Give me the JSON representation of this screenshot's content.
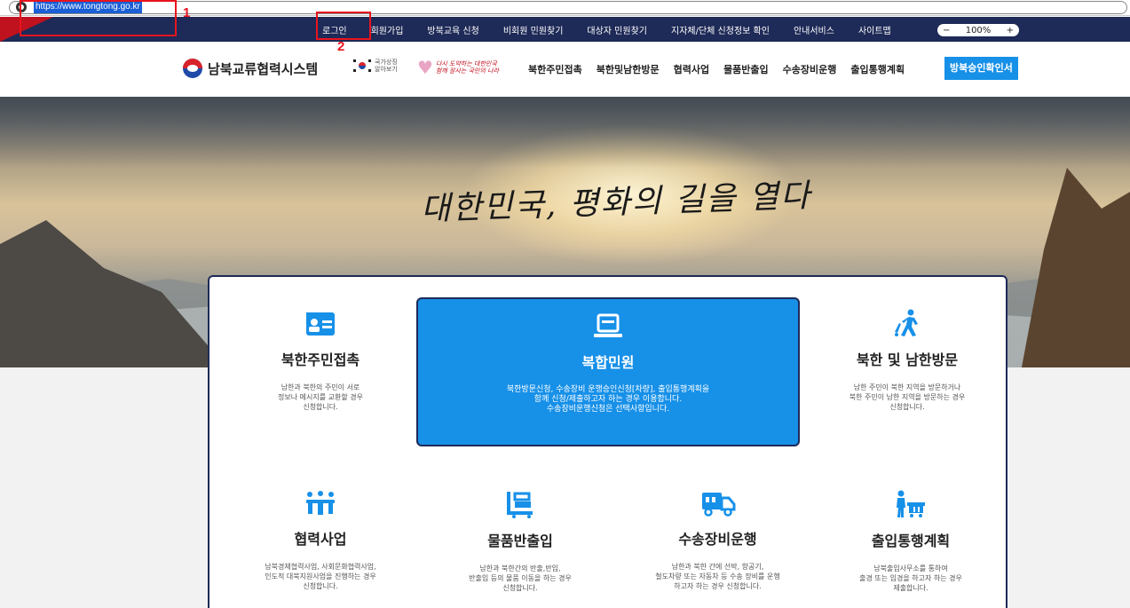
{
  "browser": {
    "url": "https://www.tongtong.go.kr"
  },
  "annotations": {
    "one": "1",
    "two": "2",
    "color": "#e8141e"
  },
  "utility": {
    "items": [
      "로그인",
      "회원가입",
      "방북교육 신청",
      "비회원 민원찾기",
      "대상자 민원찾기",
      "지자체/단체 신청정보 확인",
      "안내서비스",
      "사이트맵"
    ],
    "zoom": {
      "minus": "−",
      "value": "100%",
      "plus": "+"
    }
  },
  "header": {
    "logo_text": "남북교류협력시스템",
    "badge1_line1": "국가상징",
    "badge1_line2": "알아보기",
    "badge2_line1": "다시 도약하는 대한민국",
    "badge2_line2": "함께 잘사는 국민의 나라",
    "nav": [
      "북한주민접촉",
      "북한및남한방문",
      "협력사업",
      "물품반출입",
      "수송장비운행",
      "출입통행계획"
    ],
    "cta": "방북승인확인서"
  },
  "hero": {
    "slogan": "대한민국, 평화의 길을 열다"
  },
  "services": [
    {
      "title": "북한주민접촉",
      "icon": "id-card-icon",
      "desc": [
        "남한과 북한의 주민이 서로",
        "정보나 메시지를 교환할 경우",
        "신청합니다."
      ]
    },
    {
      "title": "복합민원",
      "icon": "laptop-icon",
      "desc": [
        "북한방문신청, 수송장비 운행승인신청[차량], 출입통행계획을",
        "함께 신청/제출하고자 하는 경우 이용합니다.",
        "수송장비운행신청은 선택사항입니다."
      ]
    },
    {
      "title": "북한 및 남한방문",
      "icon": "walking-person-icon",
      "desc": [
        "남한 주민이 북한 지역을 방문하거나",
        "북한 주민이 남한 지역을 방문하는 경우",
        "신청합니다."
      ]
    },
    {
      "title": "협력사업",
      "icon": "people-group-icon",
      "desc": [
        "남북경제협력사업, 사회문화협력사업,",
        "인도적 대북지원사업을 진행하는 경우",
        "신청합니다."
      ]
    },
    {
      "title": "물품반출입",
      "icon": "cart-icon",
      "desc": [
        "남한과 북한간의 반출,반입,",
        "반출입 등의 물품 이동을 하는 경우",
        "신청합니다."
      ]
    },
    {
      "title": "수송장비운행",
      "icon": "truck-icon",
      "desc": [
        "남한과 북한 간에 선박, 항공기,",
        "철도차량 또는 자동차 등 수송 장비를 운행",
        "하고자 하는 경우 신청합니다."
      ]
    },
    {
      "title": "출입통행계획",
      "icon": "person-cart-icon",
      "desc": [
        "남북출입사무소를 통하여",
        "출경 또는 입경을 하고자 하는 경우",
        "제출합니다."
      ]
    }
  ],
  "colors": {
    "navy": "#1e2a57",
    "accent_blue": "#1790e8",
    "icon_blue": "#1790e8"
  }
}
